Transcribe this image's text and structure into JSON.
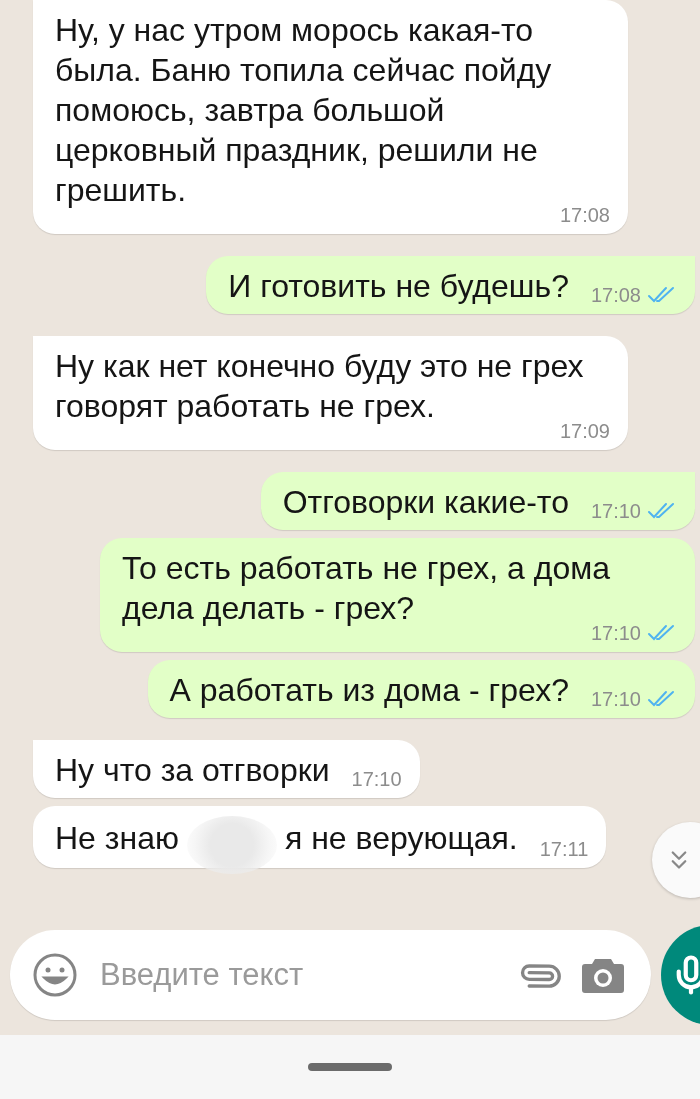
{
  "messages": [
    {
      "kind": "text",
      "outgoing": false,
      "text": "Ну, у нас утром морось какая-то была. Баню топила сейчас пойду помоюсь, завтра большой церковный праздник, решили не грешить.",
      "time": "17:08"
    },
    {
      "kind": "text",
      "outgoing": true,
      "text": "И готовить не будешь?",
      "time": "17:08",
      "read": true
    },
    {
      "kind": "text",
      "outgoing": false,
      "text": "Ну как нет конечно буду это не грех говорят работать не грех.",
      "time": "17:09"
    },
    {
      "kind": "text",
      "outgoing": true,
      "text": "Отговорки какие-то",
      "time": "17:10",
      "read": true
    },
    {
      "kind": "text",
      "outgoing": true,
      "text": "То есть работать не грех, а дома дела делать - грех?",
      "time": "17:10",
      "read": true
    },
    {
      "kind": "text",
      "outgoing": true,
      "text": "А работать из дома - грех?",
      "time": "17:10",
      "read": true
    },
    {
      "kind": "text",
      "outgoing": false,
      "text": "Ну что за отгворки",
      "time": "17:10"
    },
    {
      "kind": "redacted",
      "outgoing": false,
      "text_parts": [
        "Не знаю",
        "я не верующая."
      ],
      "time": "17:11"
    }
  ],
  "composer": {
    "placeholder": "Введите текст"
  }
}
